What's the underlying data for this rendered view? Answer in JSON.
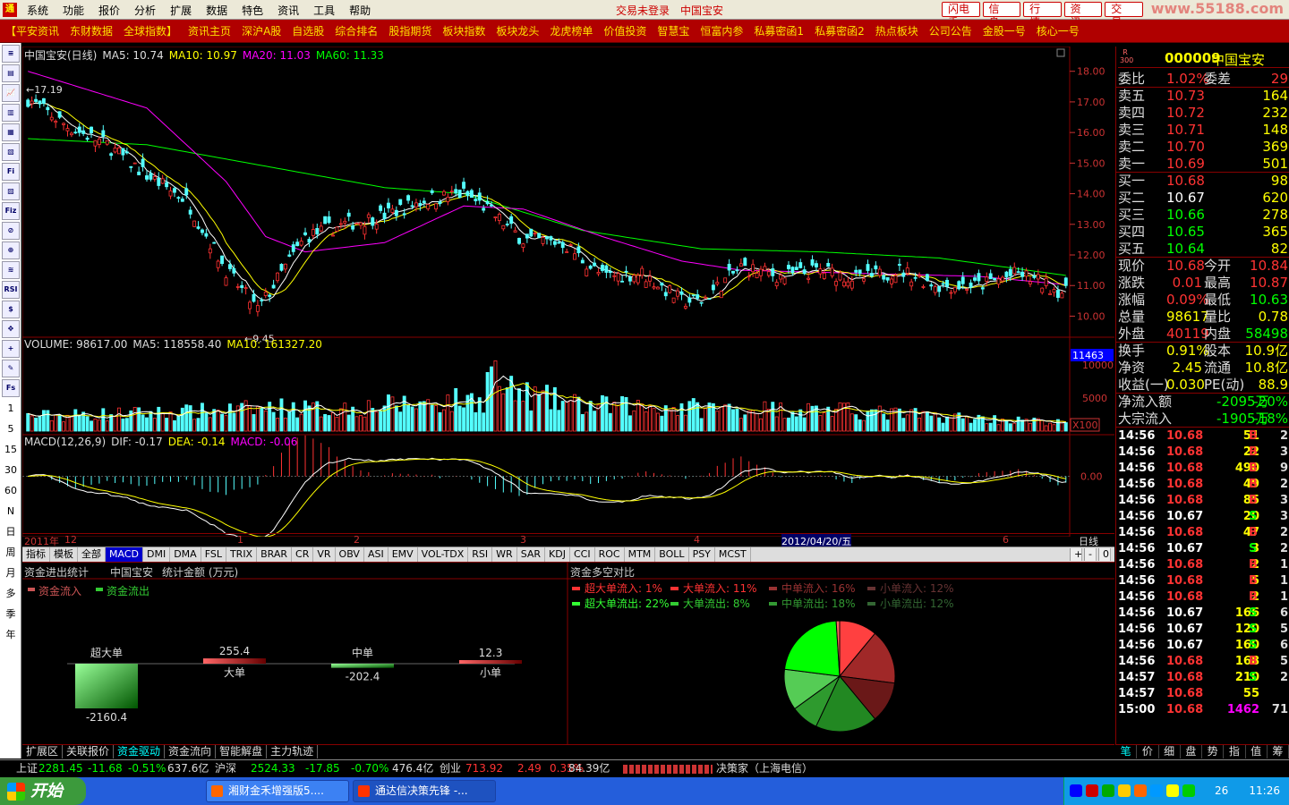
{
  "menubar": {
    "items": [
      "系统",
      "功能",
      "报价",
      "分析",
      "扩展",
      "数据",
      "特色",
      "资讯",
      "工具",
      "帮助"
    ],
    "status": "交易未登录　中国宝安",
    "buttons": [
      "闪电手",
      "信　息",
      "行　情",
      "资　讯",
      "交　易"
    ],
    "watermark": "www.55188.com"
  },
  "navbar": {
    "items": [
      "【平安资讯",
      "东财数据",
      "全球指数】",
      "资讯主页",
      "深沪A股",
      "自选股",
      "综合排名",
      "股指期货",
      "板块指数",
      "板块龙头",
      "龙虎榜单",
      "价值投资",
      "智慧宝",
      "恒富内参",
      "私募密函1",
      "私募密函2",
      "热点板块",
      "公司公告",
      "金股一号",
      "核心一号"
    ]
  },
  "lefttools": {
    "items": [
      "≡",
      "▤",
      "📈",
      "▥",
      "▦",
      "▧",
      "Fi",
      "▨",
      "Fiz",
      "⊘",
      "⊕",
      "≋",
      "RSI",
      "$",
      "✥",
      "+",
      "✎",
      "Fs",
      "1",
      "5",
      "15",
      "30",
      "60",
      "N",
      "日",
      "周",
      "月",
      "多",
      "季",
      "年"
    ]
  },
  "chart": {
    "legend_main": [
      {
        "t": "中国宝安(日线)",
        "c": "#ddd"
      },
      {
        "t": "MA5: 10.74",
        "c": "#ddd"
      },
      {
        "t": "MA10: 10.97",
        "c": "#ff0"
      },
      {
        "t": "MA20: 11.03",
        "c": "#f0f"
      },
      {
        "t": "MA60: 11.33",
        "c": "#0f0"
      }
    ],
    "legend_vol": [
      {
        "t": "VOLUME: 98617.00",
        "c": "#ddd"
      },
      {
        "t": "MA5: 118558.40",
        "c": "#ddd"
      },
      {
        "t": "MA10: 161327.20",
        "c": "#ff0"
      }
    ],
    "legend_macd": [
      {
        "t": "MACD(12,26,9)",
        "c": "#ddd"
      },
      {
        "t": "DIF: -0.17",
        "c": "#ddd"
      },
      {
        "t": "DEA: -0.14",
        "c": "#ff0"
      },
      {
        "t": "MACD: -0.06",
        "c": "#f0f"
      }
    ],
    "high_label": "←17.19",
    "low_label": "←9.45",
    "price_ticks": [
      "18.00",
      "17.00",
      "16.00",
      "15.00",
      "14.00",
      "13.00",
      "12.00",
      "11.00",
      "10.00"
    ],
    "vol_ticks": [
      "11463",
      "10000",
      "5000",
      "X100"
    ],
    "macd_ticks": [
      "0.00"
    ],
    "time_labels": [
      {
        "t": "2011年",
        "c": "#c33"
      },
      {
        "t": "12",
        "c": "#c33"
      },
      {
        "t": "1",
        "c": "#c33"
      },
      {
        "t": "2",
        "c": "#c33"
      },
      {
        "t": "3",
        "c": "#c33"
      },
      {
        "t": "4",
        "c": "#c33"
      },
      {
        "t": "2012/04/20/五",
        "c": "#fff"
      },
      {
        "t": "6",
        "c": "#c33"
      }
    ],
    "period": "日线",
    "colors": {
      "up": "#ff3232",
      "down": "#54ffff",
      "ma5": "#ffffff",
      "ma10": "#ffff00",
      "ma20": "#ff00ff",
      "ma60": "#00ff00"
    }
  },
  "chart_data": {
    "type": "candlestick",
    "title": "中国宝安(日线)",
    "price_anchors": [
      [
        0,
        17.1
      ],
      [
        10,
        16.2
      ],
      [
        20,
        15.6
      ],
      [
        30,
        14.6
      ],
      [
        40,
        13.8
      ],
      [
        50,
        11.5
      ],
      [
        58,
        10.2
      ],
      [
        63,
        11.2
      ],
      [
        70,
        12.6
      ],
      [
        80,
        13.0
      ],
      [
        90,
        13.3
      ],
      [
        100,
        13.8
      ],
      [
        110,
        14.0
      ],
      [
        115,
        13.6
      ],
      [
        125,
        12.5
      ],
      [
        135,
        12.4
      ],
      [
        145,
        11.3
      ],
      [
        155,
        11.4
      ],
      [
        165,
        10.5
      ],
      [
        170,
        10.5
      ],
      [
        180,
        11.6
      ],
      [
        190,
        11.3
      ],
      [
        200,
        11.5
      ],
      [
        210,
        11.2
      ],
      [
        220,
        11.5
      ],
      [
        230,
        11.0
      ],
      [
        240,
        11.0
      ],
      [
        250,
        11.4
      ],
      [
        262,
        10.75
      ]
    ],
    "ma60_anchors": [
      [
        0,
        15.8
      ],
      [
        30,
        15.6
      ],
      [
        60,
        14.9
      ],
      [
        90,
        14.2
      ],
      [
        110,
        14.0
      ],
      [
        140,
        12.8
      ],
      [
        170,
        12.2
      ],
      [
        200,
        12.1
      ],
      [
        230,
        11.9
      ],
      [
        262,
        11.33
      ]
    ],
    "ma20_anchors": [
      [
        0,
        18.0
      ],
      [
        30,
        16.8
      ],
      [
        50,
        14.4
      ],
      [
        60,
        12.6
      ],
      [
        70,
        12.1
      ],
      [
        90,
        12.4
      ],
      [
        110,
        13.6
      ],
      [
        125,
        13.5
      ],
      [
        145,
        12.6
      ],
      [
        165,
        11.8
      ],
      [
        180,
        11.5
      ],
      [
        210,
        11.4
      ],
      [
        240,
        11.3
      ],
      [
        262,
        11.03
      ]
    ],
    "vol_anchors": [
      [
        0,
        2200
      ],
      [
        40,
        2800
      ],
      [
        65,
        3500
      ],
      [
        75,
        3200
      ],
      [
        100,
        4200
      ],
      [
        115,
        4800
      ],
      [
        117,
        9700
      ],
      [
        120,
        6000
      ],
      [
        140,
        3800
      ],
      [
        160,
        3600
      ],
      [
        180,
        3300
      ],
      [
        200,
        3200
      ],
      [
        230,
        2200
      ],
      [
        262,
        1200
      ]
    ],
    "price_range": [
      9.4,
      18.4
    ],
    "vol_range": [
      0,
      11463
    ],
    "macd_range": [
      -0.85,
      0.55
    ]
  },
  "indicator_tabs": {
    "items": [
      "指标",
      "模板",
      "全部",
      "MACD",
      "DMI",
      "DMA",
      "FSL",
      "TRIX",
      "BRAR",
      "CR",
      "VR",
      "OBV",
      "ASI",
      "EMV",
      "VOL-TDX",
      "RSI",
      "WR",
      "SAR",
      "KDJ",
      "CCI",
      "ROC",
      "MTM",
      "BOLL",
      "PSY",
      "MCST"
    ],
    "active": 3,
    "controls": [
      "+",
      "-",
      "0"
    ]
  },
  "fund": {
    "header": [
      "资金进出统计",
      "中国宝安",
      "统计金额 (万元)"
    ],
    "legend": [
      "资金流入",
      "资金流出"
    ],
    "bars": [
      {
        "name": "超大单",
        "value": "-2160.4",
        "v": -2160.4
      },
      {
        "name": "大单",
        "value": "255.4",
        "v": 255.4
      },
      {
        "name": "中单",
        "value": "-202.4",
        "v": -202.4
      },
      {
        "name": "小单",
        "value": "12.3",
        "v": 12.3
      }
    ],
    "pie_title": "资金多空对比",
    "pie_legend": [
      {
        "t": "超大单流入:  1%",
        "c": "#ff3333"
      },
      {
        "t": "大单流入: 11%",
        "c": "#ff3333"
      },
      {
        "t": "中单流入: 16%",
        "c": "#993333"
      },
      {
        "t": "小单流入: 12%",
        "c": "#663333"
      },
      {
        "t": "超大单流出: 22%",
        "c": "#33ff33"
      },
      {
        "t": "大单流出:  8%",
        "c": "#33cc33"
      },
      {
        "t": "中单流出: 18%",
        "c": "#339933"
      },
      {
        "t": "小单流出: 12%",
        "c": "#336633"
      }
    ],
    "pie_slices": [
      {
        "v": 11,
        "c": "#ff4040"
      },
      {
        "v": 16,
        "c": "#a02828"
      },
      {
        "v": 12,
        "c": "#6a1818"
      },
      {
        "v": 18,
        "c": "#228822"
      },
      {
        "v": 8,
        "c": "#2e9a2e"
      },
      {
        "v": 12,
        "c": "#55cc55"
      },
      {
        "v": 22,
        "c": "#00ff00"
      },
      {
        "v": 1,
        "c": "#ff6060"
      }
    ]
  },
  "bottom_tabs": {
    "items": [
      "扩展区",
      "关联报价",
      "资金驱动",
      "资金流向",
      "智能解盘",
      "主力轨迹"
    ],
    "active": 2
  },
  "quote": {
    "code": "000009",
    "name": "中国宝安",
    "badge": "R 300",
    "webi": {
      "l": "委比",
      "v": "1.02%",
      "l2": "委差",
      "r": "29"
    },
    "sell": [
      {
        "l": "卖五",
        "p": "10.73",
        "q": "164"
      },
      {
        "l": "卖四",
        "p": "10.72",
        "q": "232"
      },
      {
        "l": "卖三",
        "p": "10.71",
        "q": "148"
      },
      {
        "l": "卖二",
        "p": "10.70",
        "q": "369"
      },
      {
        "l": "卖一",
        "p": "10.69",
        "q": "501"
      }
    ],
    "buy": [
      {
        "l": "买一",
        "p": "10.68",
        "q": "98",
        "c": "#f33"
      },
      {
        "l": "买二",
        "p": "10.67",
        "q": "620",
        "c": "#fff"
      },
      {
        "l": "买三",
        "p": "10.66",
        "q": "278",
        "c": "#0f0"
      },
      {
        "l": "买四",
        "p": "10.65",
        "q": "365",
        "c": "#0f0"
      },
      {
        "l": "买五",
        "p": "10.64",
        "q": "82",
        "c": "#0f0"
      }
    ],
    "stats": [
      {
        "l": "现价",
        "v": "10.68",
        "vc": "#f33",
        "l2": "今开",
        "r": "10.84",
        "rc": "#f33"
      },
      {
        "l": "涨跌",
        "v": "0.01",
        "vc": "#f33",
        "l2": "最高",
        "r": "10.87",
        "rc": "#f33"
      },
      {
        "l": "涨幅",
        "v": "0.09%",
        "vc": "#f33",
        "l2": "最低",
        "r": "10.63",
        "rc": "#0f0"
      },
      {
        "l": "总量",
        "v": "98617",
        "vc": "#ff0",
        "l2": "量比",
        "r": "0.78",
        "rc": "#ff0"
      },
      {
        "l": "外盘",
        "v": "40119",
        "vc": "#f33",
        "l2": "内盘",
        "r": "58498",
        "rc": "#0f0"
      },
      {
        "l": "换手",
        "v": "0.91%",
        "vc": "#ff0",
        "l2": "股本",
        "r": "10.9亿",
        "rc": "#ff0"
      },
      {
        "l": "净资",
        "v": "2.45",
        "vc": "#ff0",
        "l2": "流通",
        "r": "10.8亿",
        "rc": "#ff0"
      },
      {
        "l": "收益(一)",
        "v": "0.030",
        "vc": "#ff0",
        "l2": "PE(动)",
        "r": "88.9",
        "rc": "#ff0"
      }
    ],
    "flow": [
      {
        "l": "净流入额",
        "v": "-2095万",
        "r": "-20%"
      },
      {
        "l": "大宗流入",
        "v": "-1905万",
        "r": "-18%"
      }
    ],
    "ticks": [
      [
        "14:56",
        "10.68",
        "51",
        "B",
        "2"
      ],
      [
        "14:56",
        "10.68",
        "22",
        "B",
        "3"
      ],
      [
        "14:56",
        "10.68",
        "490",
        "B",
        "9"
      ],
      [
        "14:56",
        "10.68",
        "49",
        "B",
        "2"
      ],
      [
        "14:56",
        "10.68",
        "85",
        "B",
        "3"
      ],
      [
        "14:56",
        "10.67",
        "20",
        "S",
        "3"
      ],
      [
        "14:56",
        "10.68",
        "47",
        "B",
        "2"
      ],
      [
        "14:56",
        "10.67",
        "3",
        "S",
        "2"
      ],
      [
        "14:56",
        "10.68",
        "2",
        "B",
        "1"
      ],
      [
        "14:56",
        "10.68",
        "5",
        "B",
        "1"
      ],
      [
        "14:56",
        "10.68",
        "2",
        "B",
        "1"
      ],
      [
        "14:56",
        "10.67",
        "166",
        "S",
        "6"
      ],
      [
        "14:56",
        "10.67",
        "120",
        "S",
        "5"
      ],
      [
        "14:56",
        "10.67",
        "160",
        "S",
        "6"
      ],
      [
        "14:56",
        "10.68",
        "168",
        "B",
        "5"
      ],
      [
        "14:57",
        "10.68",
        "210",
        "S",
        "2"
      ],
      [
        "14:57",
        "10.68",
        "55",
        "",
        ""
      ],
      [
        "15:00",
        "10.68",
        "1462",
        "",
        "71"
      ]
    ],
    "tabs": [
      "笔",
      "价",
      "细",
      "盘",
      "势",
      "指",
      "值",
      "筹"
    ],
    "tab_active": 0
  },
  "indexbar": [
    {
      "t": "上证",
      "c": "#ddd"
    },
    {
      "t": "2281.45",
      "c": "#0f0"
    },
    {
      "t": "-11.68",
      "c": "#0f0"
    },
    {
      "t": "-0.51%",
      "c": "#0f0"
    },
    {
      "t": "637.6亿",
      "c": "#ddd"
    },
    {
      "t": "沪深",
      "c": "#ddd"
    },
    {
      "t": "2524.33",
      "c": "#0f0"
    },
    {
      "t": "-17.85",
      "c": "#0f0"
    },
    {
      "t": "-0.70%",
      "c": "#0f0"
    },
    {
      "t": "476.4亿",
      "c": "#ddd"
    },
    {
      "t": "创业",
      "c": "#ddd"
    },
    {
      "t": "713.92",
      "c": "#f33"
    },
    {
      "t": "2.49",
      "c": "#f33"
    },
    {
      "t": "0.35%",
      "c": "#f33"
    },
    {
      "t": "84.39亿",
      "c": "#ddd"
    },
    {
      "t": "决策家（上海电信）",
      "c": "#ddd"
    }
  ],
  "taskbar": {
    "start": "开始",
    "tasks": [
      "湘财金禾增强版5....",
      "通达信决策先锋 -..."
    ],
    "clock": "11:26",
    "temp": "26"
  }
}
